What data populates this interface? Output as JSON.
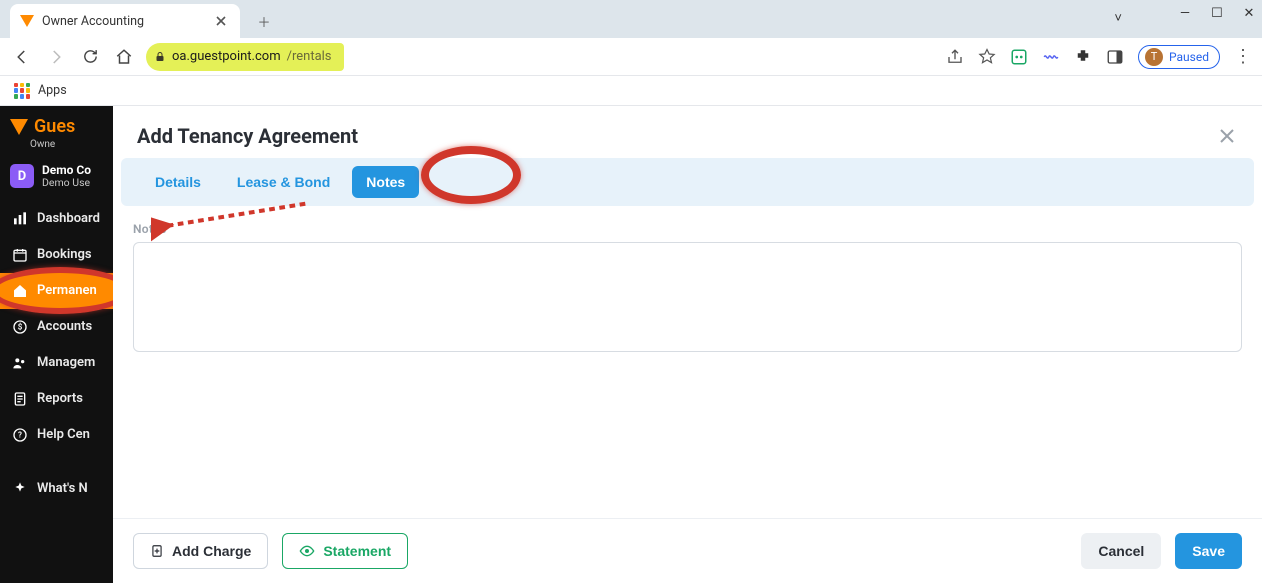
{
  "browser": {
    "tab_title": "Owner Accounting",
    "new_tab_tooltip": "New tab",
    "win_dd": "˅",
    "win_min": "—",
    "win_max": "☐",
    "win_close": "✕",
    "nav": {
      "back": "←",
      "forward": "→",
      "reload": "↻",
      "home": "⌂"
    },
    "url_domain": "oa.guestpoint.com",
    "url_path": "/rentals",
    "share_icon": "share",
    "star_icon": "star",
    "paused_label": "Paused",
    "paused_initial": "T",
    "apps_label": "Apps"
  },
  "app": {
    "brand": "Gues",
    "brand_sub": "Owne",
    "org_initial": "D",
    "org_name": "Demo Co",
    "org_user": "Demo Use",
    "nav": {
      "dashboard": "Dashboard",
      "bookings": "Bookings",
      "permanent": "Permanen",
      "accounts": "Accounts",
      "management": "Managem",
      "reports": "Reports",
      "help": "Help Cen",
      "whats_new": "What's N"
    }
  },
  "modal": {
    "title": "Add Tenancy Agreement",
    "tabs": {
      "details": "Details",
      "lease": "Lease & Bond",
      "notes": "Notes"
    },
    "notes_label": "Notes",
    "notes_value": "",
    "footer": {
      "add_charge": "Add Charge",
      "statement": "Statement",
      "cancel": "Cancel",
      "save": "Save"
    }
  }
}
